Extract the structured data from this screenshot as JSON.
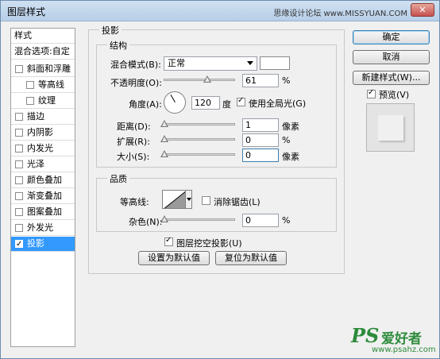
{
  "window": {
    "title": "图层样式",
    "watermark": "思缘设计论坛 www.MISSYUAN.COM",
    "close_label": "✕"
  },
  "left_panel": {
    "header": "样式",
    "blend_options": "混合选项:自定",
    "items": [
      {
        "label": "斜面和浮雕",
        "checked": false
      },
      {
        "label": "等高线",
        "checked": false
      },
      {
        "label": "纹理",
        "checked": false
      },
      {
        "label": "描边",
        "checked": false
      },
      {
        "label": "内阴影",
        "checked": false
      },
      {
        "label": "内发光",
        "checked": false
      },
      {
        "label": "光泽",
        "checked": false
      },
      {
        "label": "颜色叠加",
        "checked": false
      },
      {
        "label": "渐变叠加",
        "checked": false
      },
      {
        "label": "图案叠加",
        "checked": false
      },
      {
        "label": "外发光",
        "checked": false
      },
      {
        "label": "投影",
        "checked": true
      }
    ]
  },
  "buttons": {
    "ok": "确定",
    "cancel": "取消",
    "new_style": "新建样式(W)...",
    "preview": "预览(V)"
  },
  "drop_shadow": {
    "title": "投影",
    "structure_title": "结构",
    "blend_mode_label": "混合模式(B):",
    "blend_mode_value": "正常",
    "opacity_label": "不透明度(O):",
    "opacity_value": "61",
    "opacity_unit": "%",
    "opacity_level": 0.61,
    "angle_label": "角度(A):",
    "angle_value": "120",
    "angle_unit": "度",
    "use_global_light": "使用全局光(G)",
    "distance_label": "距离(D):",
    "distance_value": "1",
    "distance_unit": "像素",
    "spread_label": "扩展(R):",
    "spread_value": "0",
    "spread_unit": "%",
    "size_label": "大小(S):",
    "size_value": "0",
    "size_unit": "像素",
    "quality_title": "品质",
    "contour_label": "等高线:",
    "anti_aliased": "消除锯齿(L)",
    "noise_label": "杂色(N):",
    "noise_value": "0",
    "noise_unit": "%",
    "knockout": "图层挖空投影(U)",
    "make_default": "设置为默认值",
    "reset_default": "复位为默认值"
  },
  "logo": {
    "ps": "PS",
    "name": "爱好者",
    "url": "www.psahz.com"
  },
  "colors": {
    "selected": "#3399ff",
    "logo_green": "#2d8b3b",
    "shadow_color": "#ffffff"
  }
}
